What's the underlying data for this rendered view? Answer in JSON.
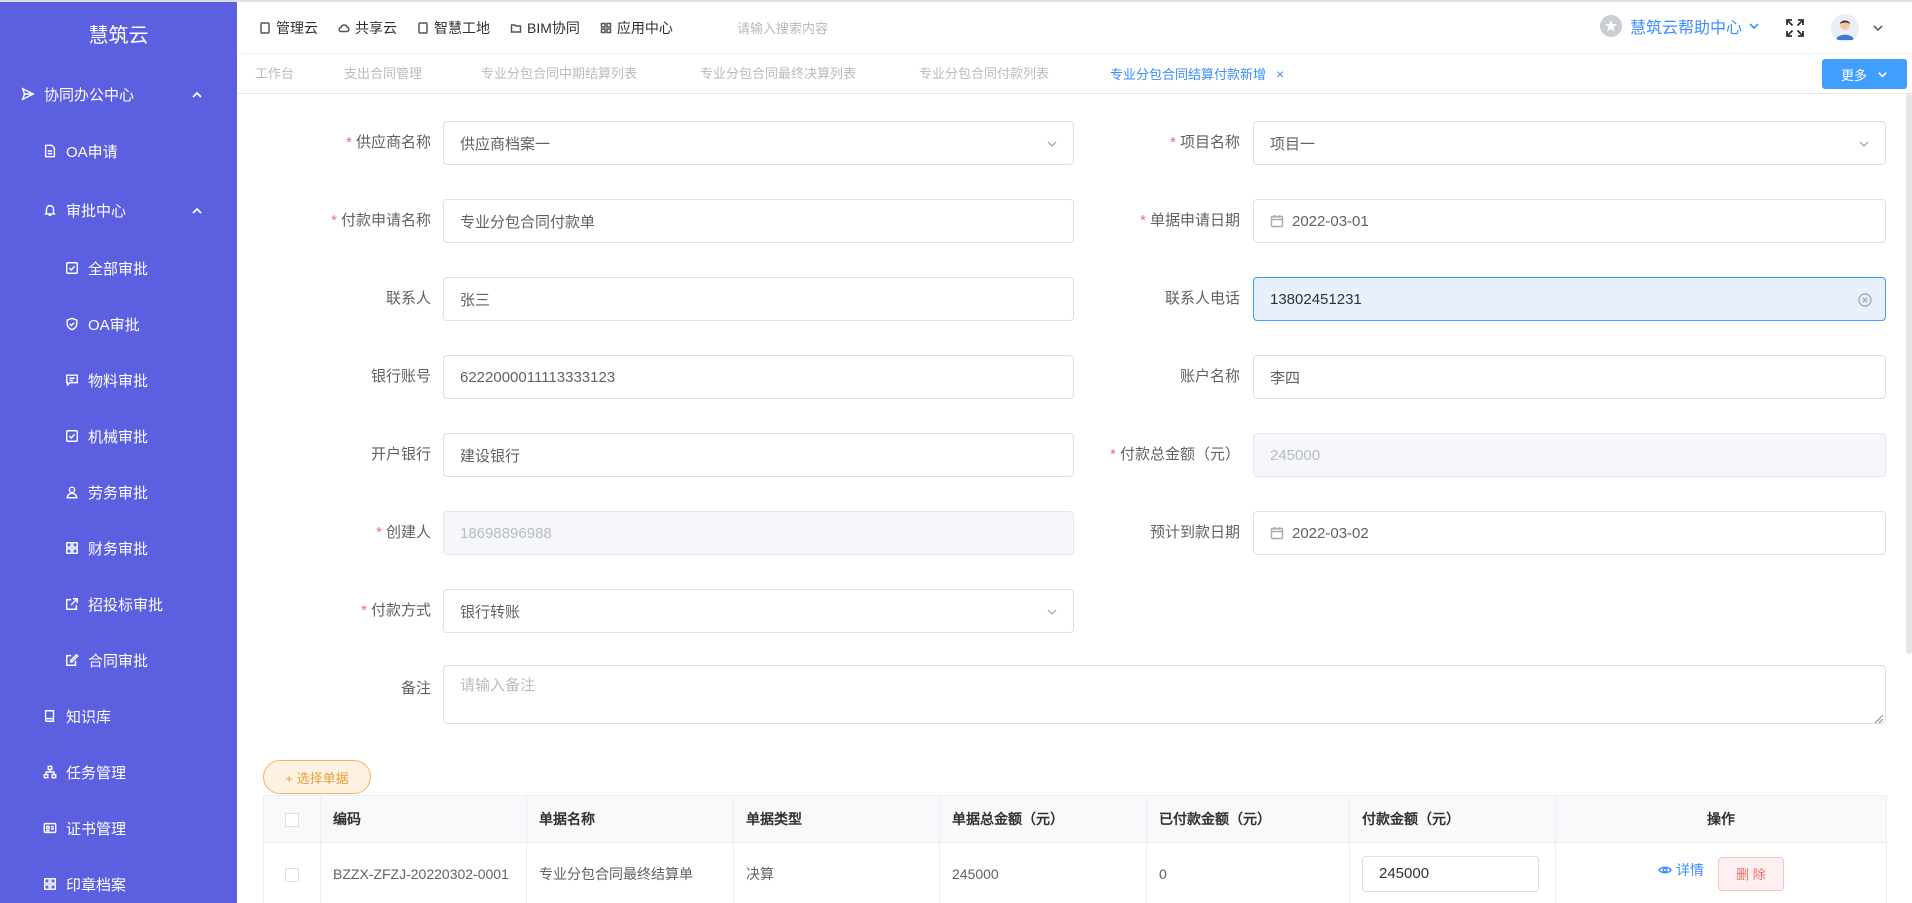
{
  "sidebar": {
    "brand": "慧筑云",
    "items": [
      {
        "label": "协同办公中心",
        "icon": "send-icon"
      },
      {
        "label": "OA申请",
        "icon": "document-icon"
      },
      {
        "label": "审批中心",
        "icon": "bell-icon"
      },
      {
        "label": "全部审批",
        "icon": "check-square-icon"
      },
      {
        "label": "OA审批",
        "icon": "shield-icon"
      },
      {
        "label": "物料审批",
        "icon": "message-icon"
      },
      {
        "label": "机械审批",
        "icon": "check-square-icon"
      },
      {
        "label": "劳务审批",
        "icon": "user-icon"
      },
      {
        "label": "财务审批",
        "icon": "grid-icon"
      },
      {
        "label": "招投标审批",
        "icon": "share-icon"
      },
      {
        "label": "合同审批",
        "icon": "edit-icon"
      },
      {
        "label": "知识库",
        "icon": "book-icon"
      },
      {
        "label": "任务管理",
        "icon": "org-icon"
      },
      {
        "label": "证书管理",
        "icon": "card-icon"
      },
      {
        "label": "印章档案",
        "icon": "grid-icon"
      }
    ]
  },
  "header": {
    "nav": [
      "管理云",
      "共享云",
      "智慧工地",
      "BIM协同",
      "应用中心"
    ],
    "search_placeholder": "请输入搜索内容",
    "help": "慧筑云帮助中心"
  },
  "tabs": {
    "items": [
      "工作台",
      "支出合同管理",
      "专业分包合同中期结算列表",
      "专业分包合同最终决算列表",
      "专业分包合同付款列表",
      "专业分包合同结算付款新增"
    ],
    "active_index": 5,
    "more": "更多"
  },
  "form": {
    "supplier": {
      "label": "供应商名称",
      "value": "供应商档案一"
    },
    "project": {
      "label": "项目名称",
      "value": "项目一"
    },
    "payment_name": {
      "label": "付款申请名称",
      "value": "专业分包合同付款单"
    },
    "apply_date": {
      "label": "单据申请日期",
      "value": "2022-03-01"
    },
    "contact": {
      "label": "联系人",
      "value": "张三"
    },
    "contact_phone": {
      "label": "联系人电话",
      "value": "13802451231"
    },
    "bank_account": {
      "label": "银行账号",
      "value": "6222000011113333123"
    },
    "account_name": {
      "label": "账户名称",
      "value": "李四"
    },
    "bank": {
      "label": "开户银行",
      "value": "建设银行"
    },
    "total_amount": {
      "label": "付款总金额（元）",
      "value": "245000"
    },
    "creator": {
      "label": "创建人",
      "value": "18698896988"
    },
    "expected_date": {
      "label": "预计到款日期",
      "value": "2022-03-02"
    },
    "pay_method": {
      "label": "付款方式",
      "value": "银行转账"
    },
    "remark": {
      "label": "备注",
      "placeholder": "请输入备注"
    },
    "select_docs": "+ 选择单据"
  },
  "table": {
    "headers": [
      "编码",
      "单据名称",
      "单据类型",
      "单据总金额（元）",
      "已付款金额（元）",
      "付款金额（元）",
      "操作"
    ],
    "rows": [
      {
        "code": "BZZX-ZFZJ-20220302-0001",
        "name": "专业分包合同最终结算单",
        "type": "决算",
        "total": "245000",
        "paid": "0",
        "amount": "245000",
        "detail": "详情",
        "delete": "删 除"
      }
    ]
  },
  "colors": {
    "sidebar": "#5b5fe0",
    "accent": "#409eff",
    "required": "#f56c6c",
    "warning": "#e6a23c"
  }
}
